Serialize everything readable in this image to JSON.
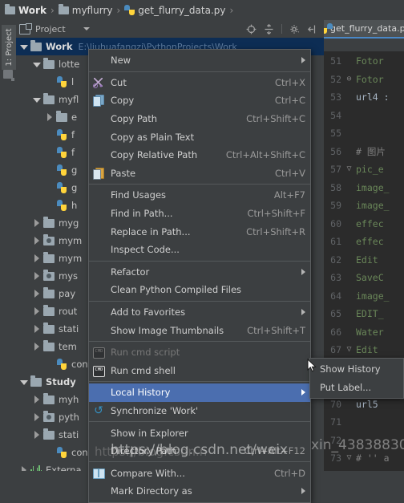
{
  "breadcrumb": {
    "items": [
      {
        "label": "Work",
        "icon": "folder-icon",
        "bold": true
      },
      {
        "label": "myflurry",
        "icon": "folder-icon",
        "bold": false
      },
      {
        "label": "get_flurry_data.py",
        "icon": "python-file-icon",
        "bold": false
      }
    ],
    "separator": "›"
  },
  "toolwindow_strip": {
    "label": "1: Project",
    "structure_icon": "structure-icon"
  },
  "project_panel": {
    "title": "Project",
    "dropdown_caret": "caret-down-icon",
    "toolbar_icons": [
      "locate-icon",
      "collapse-all-icon",
      "settings-icon",
      "hide-icon"
    ]
  },
  "tree": {
    "rows": [
      {
        "indent": 0,
        "arrow": "open",
        "icon": "folder-icon",
        "label": "Work",
        "bold": true,
        "path": "E:\\liuhuafangzi\\PythonProjects\\Work",
        "selected": true
      },
      {
        "indent": 1,
        "arrow": "open",
        "icon": "folder-icon",
        "label": "lotte",
        "bold": false,
        "path": "",
        "selected": false
      },
      {
        "indent": 2,
        "arrow": "none",
        "icon": "python-file-icon",
        "label": "l",
        "bold": false,
        "path": "",
        "selected": false
      },
      {
        "indent": 1,
        "arrow": "open",
        "icon": "folder-icon",
        "label": "myfl",
        "bold": false,
        "path": "",
        "selected": false
      },
      {
        "indent": 2,
        "arrow": "closed",
        "icon": "folder-icon",
        "label": "e",
        "bold": false,
        "path": "",
        "selected": false
      },
      {
        "indent": 2,
        "arrow": "none",
        "icon": "python-file-icon",
        "label": "f",
        "bold": false,
        "path": "",
        "selected": false
      },
      {
        "indent": 2,
        "arrow": "none",
        "icon": "python-file-icon",
        "label": "f",
        "bold": false,
        "path": "",
        "selected": false
      },
      {
        "indent": 2,
        "arrow": "none",
        "icon": "python-file-icon",
        "label": "g",
        "bold": false,
        "path": "",
        "selected": false
      },
      {
        "indent": 2,
        "arrow": "none",
        "icon": "python-file-icon",
        "label": "g",
        "bold": false,
        "path": "",
        "selected": false
      },
      {
        "indent": 2,
        "arrow": "none",
        "icon": "python-file-icon",
        "label": "h",
        "bold": false,
        "path": "",
        "selected": false
      },
      {
        "indent": 1,
        "arrow": "closed",
        "icon": "folder-icon",
        "label": "myg",
        "bold": false,
        "path": "",
        "selected": false
      },
      {
        "indent": 1,
        "arrow": "closed",
        "icon": "source-folder-icon",
        "label": "mym",
        "bold": false,
        "path": "",
        "selected": false
      },
      {
        "indent": 1,
        "arrow": "closed",
        "icon": "folder-icon",
        "label": "mym",
        "bold": false,
        "path": "",
        "selected": false
      },
      {
        "indent": 1,
        "arrow": "closed",
        "icon": "source-folder-icon",
        "label": "mys",
        "bold": false,
        "path": "",
        "selected": false
      },
      {
        "indent": 1,
        "arrow": "closed",
        "icon": "folder-icon",
        "label": "pay",
        "bold": false,
        "path": "",
        "selected": false
      },
      {
        "indent": 1,
        "arrow": "closed",
        "icon": "folder-icon",
        "label": "rout",
        "bold": false,
        "path": "",
        "selected": false
      },
      {
        "indent": 1,
        "arrow": "closed",
        "icon": "folder-icon",
        "label": "stati",
        "bold": false,
        "path": "",
        "selected": false
      },
      {
        "indent": 1,
        "arrow": "closed",
        "icon": "folder-icon",
        "label": "tem",
        "bold": false,
        "path": "",
        "selected": false
      },
      {
        "indent": 2,
        "arrow": "none",
        "icon": "python-file-icon",
        "label": "conf",
        "bold": false,
        "path": "",
        "selected": false
      },
      {
        "indent": 0,
        "arrow": "open",
        "icon": "folder-icon",
        "label": "Study",
        "bold": true,
        "path": "",
        "selected": false
      },
      {
        "indent": 1,
        "arrow": "closed",
        "icon": "folder-icon",
        "label": "myh",
        "bold": false,
        "path": "",
        "selected": false
      },
      {
        "indent": 1,
        "arrow": "closed",
        "icon": "source-folder-icon",
        "label": "pyth",
        "bold": false,
        "path": "",
        "selected": false
      },
      {
        "indent": 1,
        "arrow": "closed",
        "icon": "folder-icon",
        "label": "stati",
        "bold": false,
        "path": "",
        "selected": false
      },
      {
        "indent": 2,
        "arrow": "none",
        "icon": "python-file-icon",
        "label": "conf",
        "bold": false,
        "path": "",
        "selected": false
      },
      {
        "indent": 0,
        "arrow": "closed",
        "icon": "library-icon",
        "label": "Externa",
        "bold": false,
        "path": "",
        "selected": false
      }
    ]
  },
  "editor": {
    "tab": {
      "label": "get_flurry_data.p",
      "icon": "python-file-icon"
    },
    "lines": [
      {
        "num": "51",
        "fold": "",
        "text": "Fotor"
      },
      {
        "num": "52",
        "fold": "⊖",
        "text": "Fotor"
      },
      {
        "num": "53",
        "fold": "",
        "text": "url4 :"
      },
      {
        "num": "54",
        "fold": "",
        "text": ""
      },
      {
        "num": "55",
        "fold": "",
        "text": ""
      },
      {
        "num": "56",
        "fold": "",
        "text": "#  图片"
      },
      {
        "num": "57",
        "fold": "▽",
        "text": "pic_e"
      },
      {
        "num": "58",
        "fold": "",
        "text": "image_"
      },
      {
        "num": "59",
        "fold": "",
        "text": "image_"
      },
      {
        "num": "60",
        "fold": "",
        "text": "effec"
      },
      {
        "num": "61",
        "fold": "",
        "text": "effec"
      },
      {
        "num": "62",
        "fold": "",
        "text": "Edit"
      },
      {
        "num": "63",
        "fold": "",
        "text": "SaveC"
      },
      {
        "num": "64",
        "fold": "",
        "text": "image_"
      },
      {
        "num": "65",
        "fold": "",
        "text": "EDIT_"
      },
      {
        "num": "66",
        "fold": "",
        "text": "Water"
      },
      {
        "num": "67",
        "fold": "▽",
        "text": "Edit"
      },
      {
        "num": "68",
        "fold": "",
        "text": ""
      },
      {
        "num": "69",
        "fold": "",
        "text": ""
      },
      {
        "num": "70",
        "fold": "",
        "text": "url5 "
      },
      {
        "num": "71",
        "fold": "",
        "text": ""
      },
      {
        "num": "72",
        "fold": "",
        "text": ""
      },
      {
        "num": "73",
        "fold": "▽",
        "text": "# '' a"
      }
    ]
  },
  "context_menu": {
    "items": [
      {
        "type": "item",
        "label": "New",
        "accel": "",
        "icon": "",
        "submenu": true,
        "disabled": false,
        "highlighted": false
      },
      {
        "type": "separator"
      },
      {
        "type": "item",
        "label": "Cut",
        "accel": "Ctrl+X",
        "icon": "cut-icon",
        "submenu": false,
        "disabled": false,
        "highlighted": false
      },
      {
        "type": "item",
        "label": "Copy",
        "accel": "Ctrl+C",
        "icon": "copy-icon",
        "submenu": false,
        "disabled": false,
        "highlighted": false
      },
      {
        "type": "item",
        "label": "Copy Path",
        "accel": "Ctrl+Shift+C",
        "icon": "",
        "submenu": false,
        "disabled": false,
        "highlighted": false
      },
      {
        "type": "item",
        "label": "Copy as Plain Text",
        "accel": "",
        "icon": "",
        "submenu": false,
        "disabled": false,
        "highlighted": false
      },
      {
        "type": "item",
        "label": "Copy Relative Path",
        "accel": "Ctrl+Alt+Shift+C",
        "icon": "",
        "submenu": false,
        "disabled": false,
        "highlighted": false
      },
      {
        "type": "item",
        "label": "Paste",
        "accel": "Ctrl+V",
        "icon": "paste-icon",
        "submenu": false,
        "disabled": false,
        "highlighted": false
      },
      {
        "type": "separator"
      },
      {
        "type": "item",
        "label": "Find Usages",
        "accel": "Alt+F7",
        "icon": "",
        "submenu": false,
        "disabled": false,
        "highlighted": false
      },
      {
        "type": "item",
        "label": "Find in Path...",
        "accel": "Ctrl+Shift+F",
        "icon": "",
        "submenu": false,
        "disabled": false,
        "highlighted": false
      },
      {
        "type": "item",
        "label": "Replace in Path...",
        "accel": "Ctrl+Shift+R",
        "icon": "",
        "submenu": false,
        "disabled": false,
        "highlighted": false
      },
      {
        "type": "item",
        "label": "Inspect Code...",
        "accel": "",
        "icon": "",
        "submenu": false,
        "disabled": false,
        "highlighted": false
      },
      {
        "type": "separator"
      },
      {
        "type": "item",
        "label": "Refactor",
        "accel": "",
        "icon": "",
        "submenu": true,
        "disabled": false,
        "highlighted": false
      },
      {
        "type": "item",
        "label": "Clean Python Compiled Files",
        "accel": "",
        "icon": "",
        "submenu": false,
        "disabled": false,
        "highlighted": false
      },
      {
        "type": "separator"
      },
      {
        "type": "item",
        "label": "Add to Favorites",
        "accel": "",
        "icon": "",
        "submenu": true,
        "disabled": false,
        "highlighted": false
      },
      {
        "type": "item",
        "label": "Show Image Thumbnails",
        "accel": "Ctrl+Shift+T",
        "icon": "",
        "submenu": false,
        "disabled": false,
        "highlighted": false
      },
      {
        "type": "separator"
      },
      {
        "type": "item",
        "label": "Run cmd script",
        "accel": "",
        "icon": "cmd-icon",
        "submenu": false,
        "disabled": true,
        "highlighted": false
      },
      {
        "type": "item",
        "label": "Run cmd shell",
        "accel": "",
        "icon": "cmd-icon",
        "submenu": false,
        "disabled": false,
        "highlighted": false
      },
      {
        "type": "separator"
      },
      {
        "type": "item",
        "label": "Local History",
        "accel": "",
        "icon": "",
        "submenu": true,
        "disabled": false,
        "highlighted": true
      },
      {
        "type": "item",
        "label": "Synchronize 'Work'",
        "accel": "",
        "icon": "sync-icon",
        "submenu": false,
        "disabled": false,
        "highlighted": false
      },
      {
        "type": "separator"
      },
      {
        "type": "item",
        "label": "Show in Explorer",
        "accel": "",
        "icon": "",
        "submenu": false,
        "disabled": false,
        "highlighted": false
      },
      {
        "type": "item",
        "label": "Directory Path",
        "accel": "Ctrl+Alt+F12",
        "icon": "",
        "submenu": false,
        "disabled": false,
        "highlighted": false
      },
      {
        "type": "separator"
      },
      {
        "type": "item",
        "label": "Compare With...",
        "accel": "Ctrl+D",
        "icon": "compare-icon",
        "submenu": false,
        "disabled": false,
        "highlighted": false
      },
      {
        "type": "item",
        "label": "Mark Directory as",
        "accel": "",
        "icon": "",
        "submenu": true,
        "disabled": false,
        "highlighted": false
      }
    ]
  },
  "submenu": {
    "items": [
      {
        "label": "Show History"
      },
      {
        "label": "Put Label..."
      }
    ]
  },
  "watermark": {
    "text": "https://blog.csdn.net/weix",
    "ghost": "https://blog.csdn.n",
    "code": "xin_43838830"
  },
  "colors": {
    "panel_bg": "#3c3f41",
    "editor_bg": "#2b2b2b",
    "menu_bg": "#3c3f41",
    "highlight": "#4b6eaf",
    "tree_selected": "#0d2d54",
    "tab_underline": "#4a88c7",
    "accent_string": "#6a8759",
    "accent_keyword": "#cc7832"
  }
}
